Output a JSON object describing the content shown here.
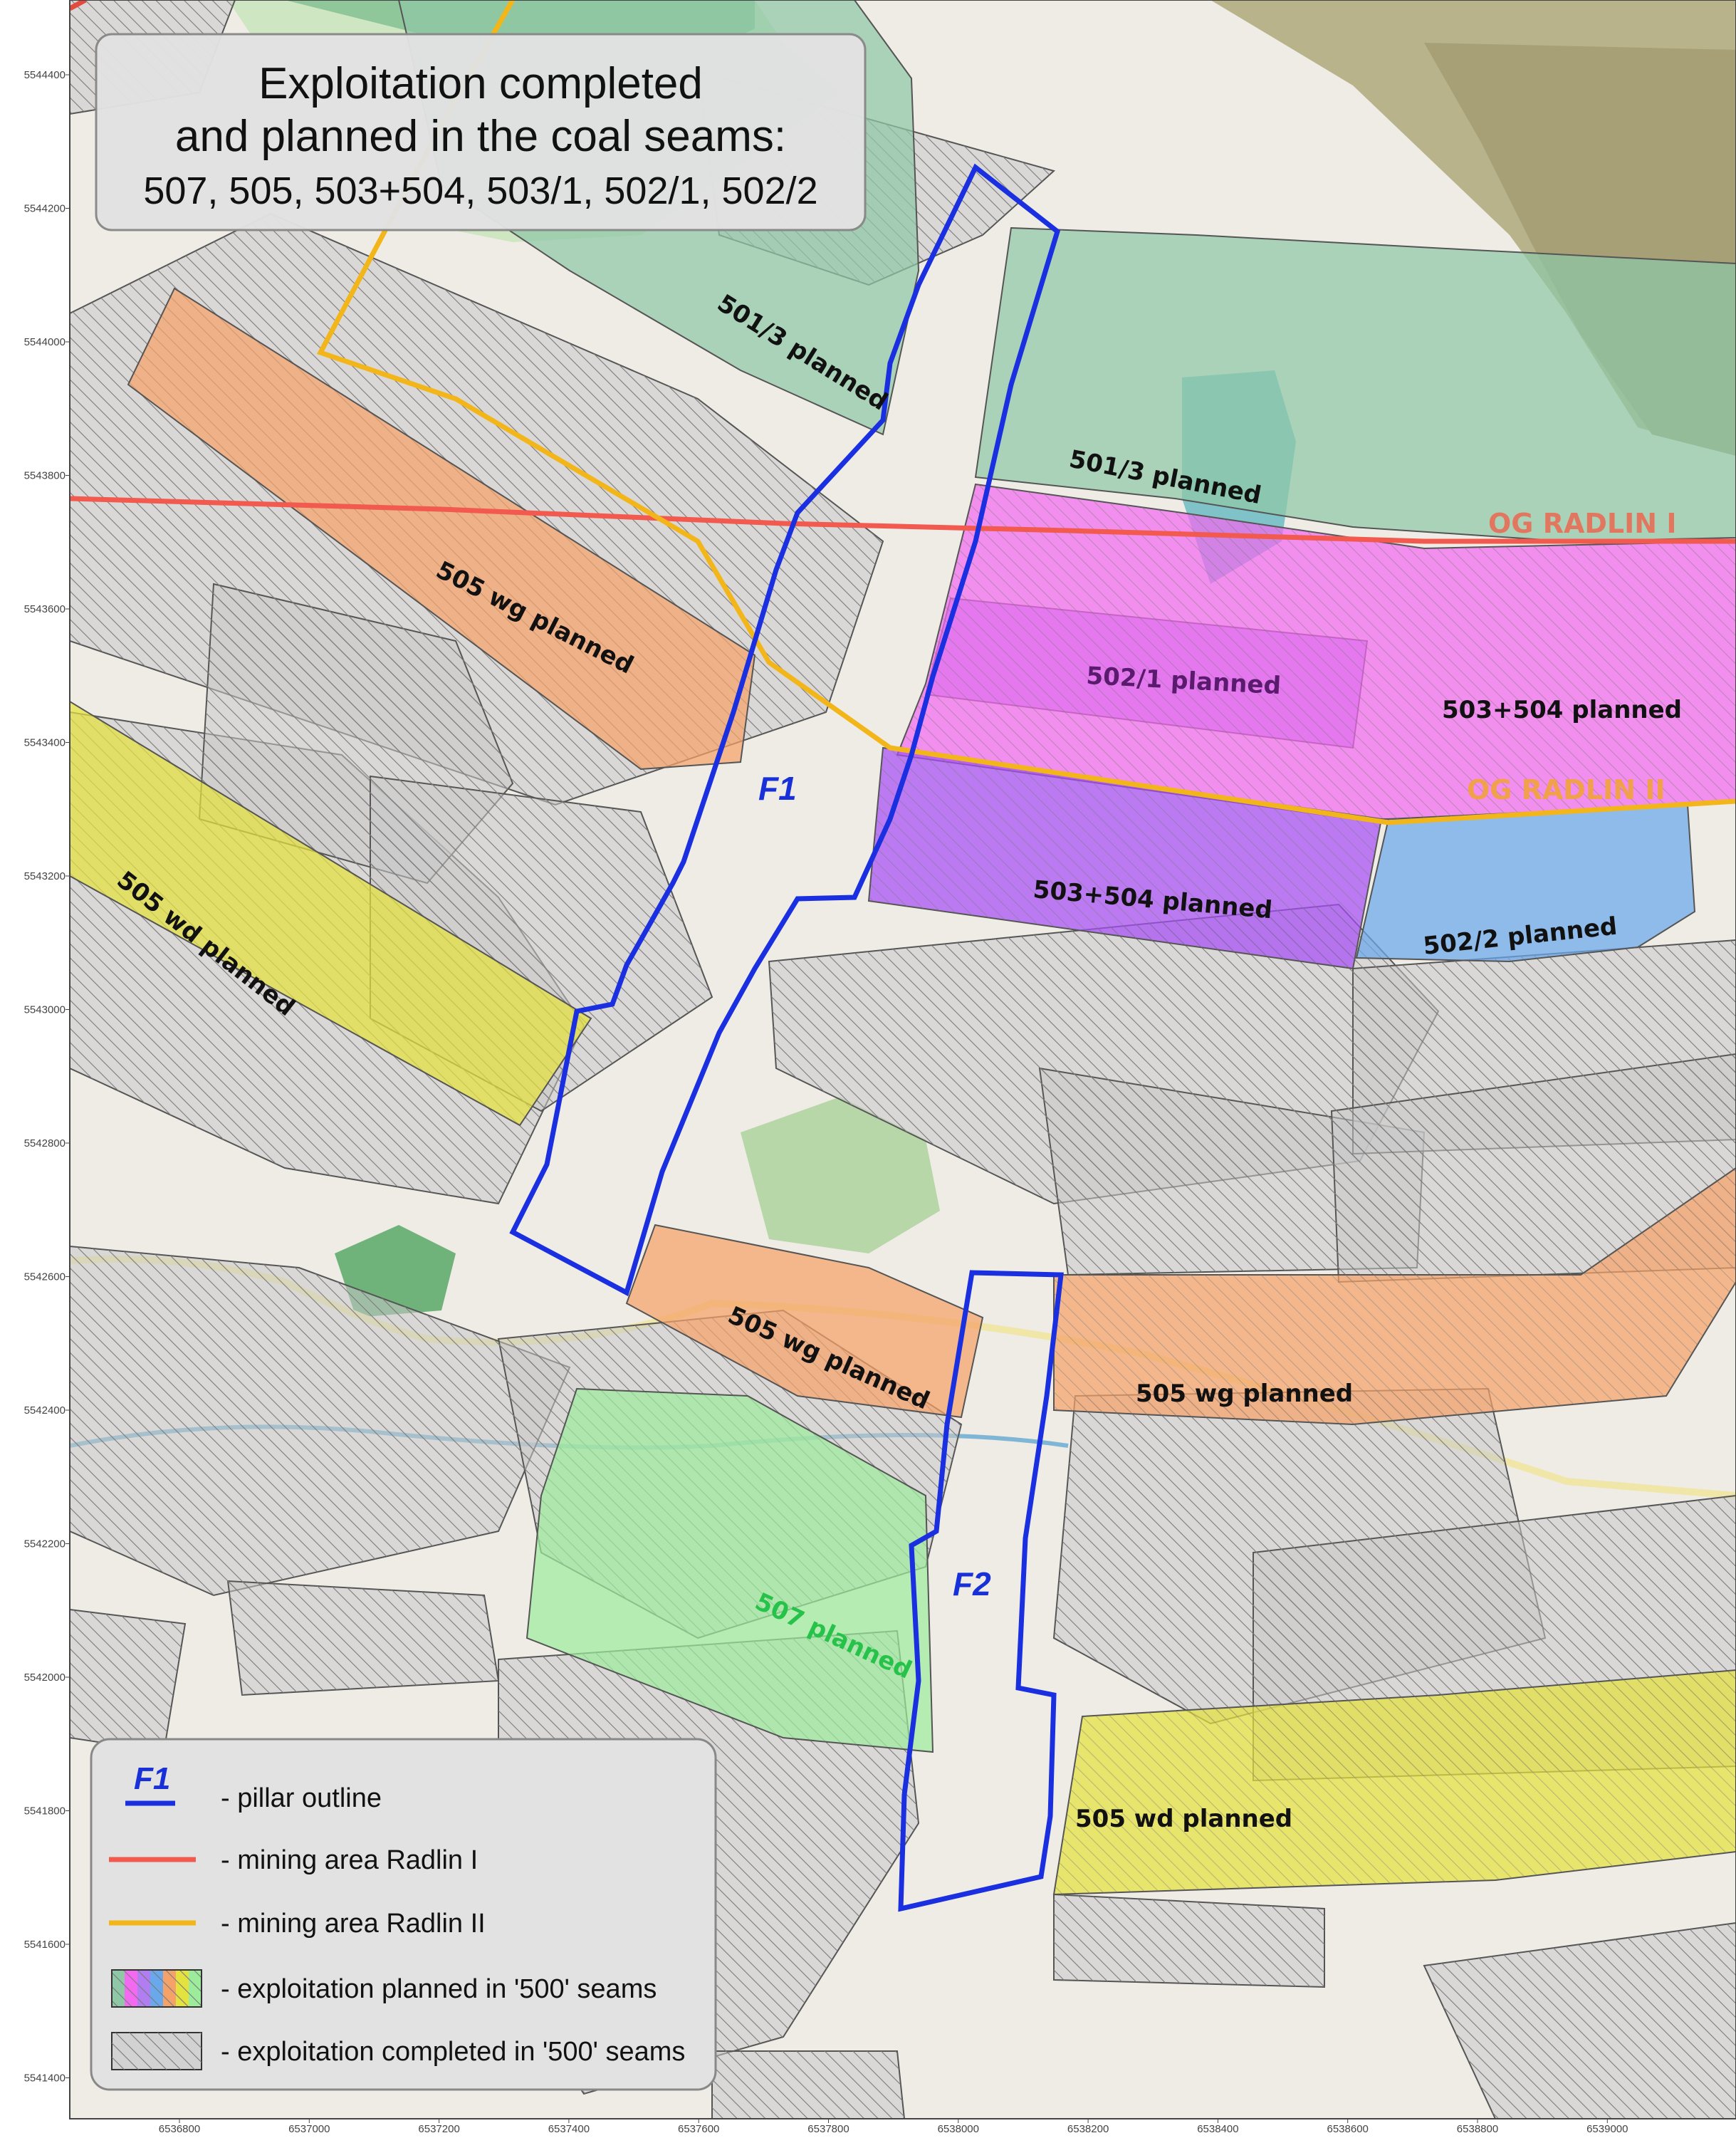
{
  "title": {
    "line1": "Exploitation completed",
    "line2": "and planned in the coal seams:",
    "line3": "507, 505, 503+504, 503/1, 502/1, 502/2"
  },
  "zones": [
    {
      "id": "501-3-a",
      "label": "501/3 planned",
      "color": "#8fc8a6"
    },
    {
      "id": "501-3-b",
      "label": "501/3 planned",
      "color": "#8fc8a6"
    },
    {
      "id": "505-wg-a",
      "label": "505 wg planned",
      "color": "#f5a26a"
    },
    {
      "id": "505-wg-b",
      "label": "505 wg planned",
      "color": "#f5a26a"
    },
    {
      "id": "505-wg-c",
      "label": "505 wg planned",
      "color": "#f5a26a"
    },
    {
      "id": "505-wd-a",
      "label": "505 wd planned",
      "color": "#e4e23e"
    },
    {
      "id": "505-wd-b",
      "label": "505 wd planned",
      "color": "#e4e23e"
    },
    {
      "id": "502-1",
      "label": "502/1 planned",
      "color": "#b07ef0"
    },
    {
      "id": "503-504-a",
      "label": "503+504 planned",
      "color": "#f36af0"
    },
    {
      "id": "503-504-b",
      "label": "503+504 planned",
      "color": "#a64ef6"
    },
    {
      "id": "502-2",
      "label": "502/2 planned",
      "color": "#6aa8ec"
    },
    {
      "id": "507",
      "label": "507 planned",
      "color": "#9cec9c"
    }
  ],
  "mining_areas": [
    {
      "label": "OG RADLIN I",
      "color": "#f25a4f"
    },
    {
      "label": "OG RADLIN II",
      "color": "#f2b61a"
    }
  ],
  "pillars": [
    {
      "label": "F1",
      "outline_color": "#1a2fe0"
    },
    {
      "label": "F2",
      "outline_color": "#1a2fe0"
    }
  ],
  "axes": {
    "y_ticks": [
      "5544400",
      "5544200",
      "5544000",
      "5543800",
      "5543600",
      "5543400",
      "5543200",
      "5543000",
      "5542800",
      "5542600",
      "5542400",
      "5542200",
      "5542000",
      "5541800",
      "5541600",
      "5541400"
    ],
    "x_ticks": [
      "6536800",
      "6537000",
      "6537200",
      "6537400",
      "6537600",
      "6537800",
      "6538000",
      "6538200",
      "6538400",
      "6538600",
      "6538800",
      "6539000"
    ]
  },
  "legend": {
    "pillar_symbol": "F1",
    "items": [
      {
        "label": "- pillar outline",
        "icon": "blue-line-icon"
      },
      {
        "label": "- mining area Radlin I",
        "icon": "red-line-icon"
      },
      {
        "label": "- mining area Radlin II",
        "icon": "yellow-line-icon"
      },
      {
        "label": "- exploitation planned in '500' seams",
        "icon": "multicolor-swatch-icon"
      },
      {
        "label": "- exploitation completed in '500' seams",
        "icon": "hatched-swatch-icon"
      }
    ],
    "swatch_colors": [
      "#8fc8a6",
      "#f36af0",
      "#b07ef0",
      "#6aa8ec",
      "#f5a26a",
      "#e4e23e",
      "#9cec9c"
    ]
  }
}
